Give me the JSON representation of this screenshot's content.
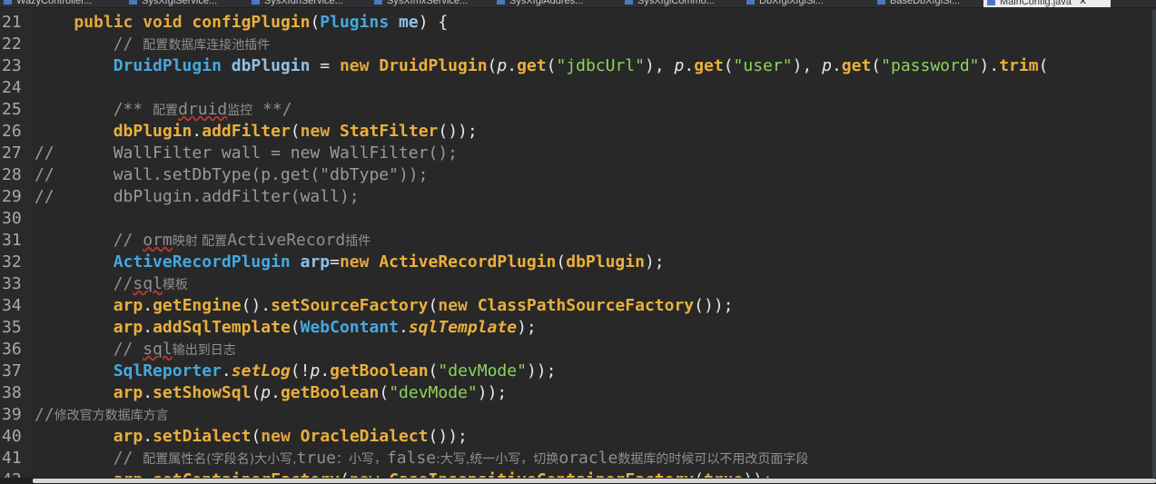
{
  "tabs": [
    {
      "label": "WazyController..."
    },
    {
      "label": "SysXfglService..."
    },
    {
      "label": "SysXfdhService..."
    },
    {
      "label": "SysXfmxService..."
    },
    {
      "label": "SysXfglAddres..."
    },
    {
      "label": "SysXfglCommo..."
    },
    {
      "label": "DbXfglXfglSi..."
    },
    {
      "label": "BaseDbXfglSi..."
    },
    {
      "label": "MainConfig.java",
      "close": "✕"
    }
  ],
  "lines": [
    {
      "n": "21",
      "segs": [
        [
          "pl",
          "    "
        ],
        [
          "kw",
          "public void "
        ],
        [
          "fn",
          "configPlugin"
        ],
        [
          "pl",
          "("
        ],
        [
          "ty",
          "Plugins"
        ],
        [
          "pl",
          " "
        ],
        [
          "tl",
          "me"
        ],
        [
          "pl",
          ") {"
        ]
      ]
    },
    {
      "n": "22",
      "segs": [
        [
          "pl",
          "        "
        ],
        [
          "cm",
          "// "
        ],
        [
          "cm zh",
          "配置数据库连接池插件"
        ]
      ]
    },
    {
      "n": "23",
      "segs": [
        [
          "pl",
          "        "
        ],
        [
          "ty",
          "DruidPlugin "
        ],
        [
          "tl",
          "dbPlugin"
        ],
        [
          "pl",
          " = "
        ],
        [
          "kw",
          "new "
        ],
        [
          "fn",
          "DruidPlugin"
        ],
        [
          "pl",
          "("
        ],
        [
          "pl it",
          "p"
        ],
        [
          "pl",
          "."
        ],
        [
          "fn",
          "get"
        ],
        [
          "pl",
          "("
        ],
        [
          "str",
          "\"jdbcUrl\""
        ],
        [
          "pl",
          "), "
        ],
        [
          "pl it",
          "p"
        ],
        [
          "pl",
          "."
        ],
        [
          "fn",
          "get"
        ],
        [
          "pl",
          "("
        ],
        [
          "str",
          "\"user\""
        ],
        [
          "pl",
          "), "
        ],
        [
          "pl it",
          "p"
        ],
        [
          "pl",
          "."
        ],
        [
          "fn",
          "get"
        ],
        [
          "pl",
          "("
        ],
        [
          "str",
          "\"password\""
        ],
        [
          "pl",
          ")."
        ],
        [
          "fn",
          "trim"
        ],
        [
          "pl",
          "("
        ]
      ]
    },
    {
      "n": "24",
      "segs": []
    },
    {
      "n": "25",
      "segs": [
        [
          "pl",
          "        "
        ],
        [
          "cm",
          "/** "
        ],
        [
          "cm zh",
          "配置"
        ],
        [
          "cm sq",
          "druid"
        ],
        [
          "cm zh",
          "监控"
        ],
        [
          "cm",
          " **/"
        ]
      ]
    },
    {
      "n": "26",
      "segs": [
        [
          "pl",
          "        "
        ],
        [
          "fn",
          "dbPlugin"
        ],
        [
          "pl",
          "."
        ],
        [
          "fn",
          "addFilter"
        ],
        [
          "pl",
          "("
        ],
        [
          "kw",
          "new "
        ],
        [
          "fn",
          "StatFilter"
        ],
        [
          "pl",
          "());"
        ]
      ]
    },
    {
      "n": "27",
      "segs": [
        [
          "cmt",
          "//      WallFilter wall = new WallFilter();"
        ]
      ]
    },
    {
      "n": "28",
      "segs": [
        [
          "cmt",
          "//      wall.setDbType(p.get(\"dbType\"));"
        ]
      ]
    },
    {
      "n": "29",
      "segs": [
        [
          "cmt",
          "//      dbPlugin.addFilter(wall);"
        ]
      ]
    },
    {
      "n": "30",
      "segs": []
    },
    {
      "n": "31",
      "segs": [
        [
          "pl",
          "        "
        ],
        [
          "cm",
          "// "
        ],
        [
          "cm sq",
          "orm"
        ],
        [
          "cm zh",
          "映射 配置"
        ],
        [
          "cm",
          "ActiveRecord"
        ],
        [
          "cm zh",
          "插件"
        ]
      ]
    },
    {
      "n": "32",
      "segs": [
        [
          "pl",
          "        "
        ],
        [
          "ty",
          "ActiveRecordPlugin "
        ],
        [
          "tl",
          "arp"
        ],
        [
          "pl",
          "="
        ],
        [
          "kw",
          "new "
        ],
        [
          "fn",
          "ActiveRecordPlugin"
        ],
        [
          "pl",
          "("
        ],
        [
          "fn",
          "dbPlugin"
        ],
        [
          "pl",
          ");"
        ]
      ]
    },
    {
      "n": "33",
      "segs": [
        [
          "pl",
          "        "
        ],
        [
          "cm",
          "//"
        ],
        [
          "cm sq",
          "sql"
        ],
        [
          "cm zh",
          "模板"
        ]
      ]
    },
    {
      "n": "34",
      "segs": [
        [
          "pl",
          "        "
        ],
        [
          "fn",
          "arp"
        ],
        [
          "pl",
          "."
        ],
        [
          "fn",
          "getEngine"
        ],
        [
          "pl",
          "()."
        ],
        [
          "fn",
          "setSourceFactory"
        ],
        [
          "pl",
          "("
        ],
        [
          "kw",
          "new "
        ],
        [
          "fn",
          "ClassPathSourceFactory"
        ],
        [
          "pl",
          "());"
        ]
      ]
    },
    {
      "n": "35",
      "segs": [
        [
          "pl",
          "        "
        ],
        [
          "fn",
          "arp"
        ],
        [
          "pl",
          "."
        ],
        [
          "fn",
          "addSqlTemplate"
        ],
        [
          "pl",
          "("
        ],
        [
          "ty",
          "WebContant"
        ],
        [
          "pl",
          "."
        ],
        [
          "fn it",
          "sqlTemplate"
        ],
        [
          "pl",
          ");"
        ]
      ]
    },
    {
      "n": "36",
      "segs": [
        [
          "pl",
          "        "
        ],
        [
          "cm",
          "// "
        ],
        [
          "cm sq",
          "sql"
        ],
        [
          "cm zh",
          "输出到日志"
        ]
      ]
    },
    {
      "n": "37",
      "segs": [
        [
          "pl",
          "        "
        ],
        [
          "ty",
          "SqlReporter"
        ],
        [
          "pl",
          "."
        ],
        [
          "fn it",
          "setLog"
        ],
        [
          "pl",
          "(!"
        ],
        [
          "pl it",
          "p"
        ],
        [
          "pl",
          "."
        ],
        [
          "fn",
          "getBoolean"
        ],
        [
          "pl",
          "("
        ],
        [
          "str",
          "\"devMode\""
        ],
        [
          "pl",
          "));"
        ]
      ]
    },
    {
      "n": "38",
      "segs": [
        [
          "pl",
          "        "
        ],
        [
          "fn",
          "arp"
        ],
        [
          "pl",
          "."
        ],
        [
          "fn",
          "setShowSql"
        ],
        [
          "pl",
          "("
        ],
        [
          "pl it",
          "p"
        ],
        [
          "pl",
          "."
        ],
        [
          "fn",
          "getBoolean"
        ],
        [
          "pl",
          "("
        ],
        [
          "str",
          "\"devMode\""
        ],
        [
          "pl",
          "));"
        ]
      ]
    },
    {
      "n": "39",
      "segs": [
        [
          "cm",
          "//"
        ],
        [
          "cm zh",
          "修改官方数据库方言"
        ]
      ]
    },
    {
      "n": "40",
      "segs": [
        [
          "pl",
          "        "
        ],
        [
          "fn",
          "arp"
        ],
        [
          "pl",
          "."
        ],
        [
          "fn",
          "setDialect"
        ],
        [
          "pl",
          "("
        ],
        [
          "kw",
          "new "
        ],
        [
          "fn",
          "OracleDialect"
        ],
        [
          "pl",
          "());"
        ]
      ]
    },
    {
      "n": "41",
      "segs": [
        [
          "pl",
          "        "
        ],
        [
          "cm",
          "// "
        ],
        [
          "cm zh",
          "配置属性名(字段名)大小写,"
        ],
        [
          "cm",
          "true"
        ],
        [
          "cm zh",
          "：小写，"
        ],
        [
          "cm",
          "false"
        ],
        [
          "cm zh",
          ":大写,统一小写，切换"
        ],
        [
          "cm",
          "oracle"
        ],
        [
          "cm zh",
          "数据库的时候可以不用改页面字段"
        ]
      ]
    },
    {
      "n": "42",
      "segs": [
        [
          "pl",
          "        "
        ],
        [
          "fn",
          "arp"
        ],
        [
          "pl",
          "."
        ],
        [
          "fn",
          "setContainerFactory"
        ],
        [
          "pl",
          "("
        ],
        [
          "kw",
          "new "
        ],
        [
          "fn",
          "CaseInsensitiveContainerFactory"
        ],
        [
          "pl",
          "("
        ],
        [
          "kw",
          "true"
        ],
        [
          "pl",
          "));"
        ]
      ]
    }
  ],
  "colors": {
    "background": "#282828",
    "keyword": "#e0a844",
    "type": "#45a8e0",
    "string": "#8ed35a",
    "comment": "#8f8f8f"
  }
}
